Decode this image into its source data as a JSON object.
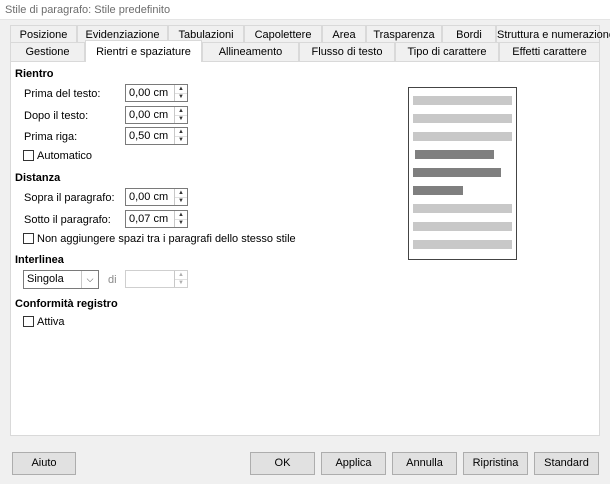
{
  "window": {
    "title": "Stile di paragrafo: Stile predefinito"
  },
  "tabs_row1": [
    {
      "label": "Posizione"
    },
    {
      "label": "Evidenziazione"
    },
    {
      "label": "Tabulazioni"
    },
    {
      "label": "Capolettere"
    },
    {
      "label": "Area"
    },
    {
      "label": "Trasparenza"
    },
    {
      "label": "Bordi"
    },
    {
      "label": "Struttura e numerazione"
    }
  ],
  "tabs_row2": [
    {
      "label": "Gestione"
    },
    {
      "label": "Rientri e spaziature",
      "active": true
    },
    {
      "label": "Allineamento"
    },
    {
      "label": "Flusso di testo"
    },
    {
      "label": "Tipo di carattere"
    },
    {
      "label": "Effetti carattere"
    }
  ],
  "rientro": {
    "heading": "Rientro",
    "before_text": {
      "label": "Prima del testo:",
      "value": "0,00 cm"
    },
    "after_text": {
      "label": "Dopo il testo:",
      "value": "0,00 cm"
    },
    "first_line": {
      "label": "Prima riga:",
      "value": "0,50 cm"
    },
    "automatic": {
      "label": "Automatico",
      "checked": false
    }
  },
  "distanza": {
    "heading": "Distanza",
    "above": {
      "label": "Sopra il paragrafo:",
      "value": "0,00 cm"
    },
    "below": {
      "label": "Sotto il paragrafo:",
      "value": "0,07 cm"
    },
    "no_space": {
      "label": "Non aggiungere spazi tra i paragrafi dello stesso stile",
      "checked": false
    }
  },
  "interlinea": {
    "heading": "Interlinea",
    "selected": "Singola",
    "of_label": "di",
    "of_value": ""
  },
  "conformita": {
    "heading": "Conformità registro",
    "active": {
      "label": "Attiva",
      "checked": false
    }
  },
  "buttons": {
    "help": "Aiuto",
    "ok": "OK",
    "apply": "Applica",
    "cancel": "Annulla",
    "reset": "Ripristina",
    "standard": "Standard"
  },
  "colors": {
    "preview_light": "#c8c8c8",
    "preview_dark": "#7f7f7f"
  }
}
